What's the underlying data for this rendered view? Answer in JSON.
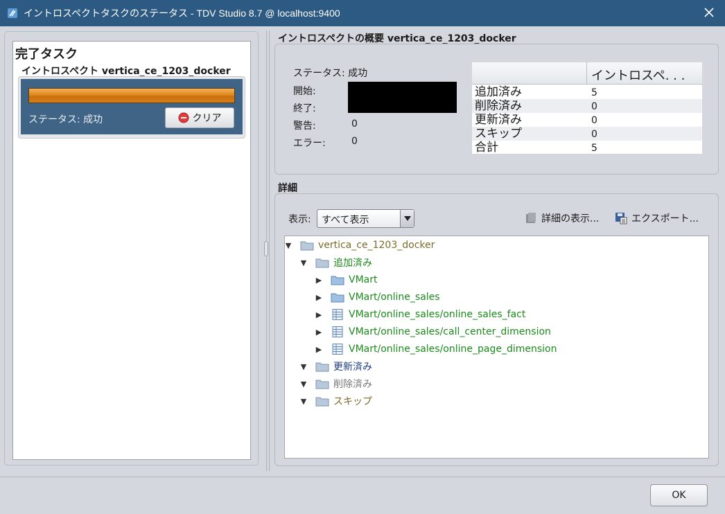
{
  "window": {
    "title": "イントロスペクトタスクのステータス - TDV Studio 8.7 @ localhost:9400",
    "icons": {
      "app": "tdv-app-icon",
      "close": "close-icon"
    }
  },
  "left_panel": {
    "heading": "完了タスク",
    "task": {
      "name": "イントロスペクト vertica_ce_1203_docker",
      "progress": 1.0,
      "status": "ステータス: 成功",
      "clear_button": "クリア",
      "clear_icon": "clear-icon"
    }
  },
  "summary": {
    "heading": "イントロスペクトの概要  vertica_ce_1203_docker",
    "status": "ステータス: 成功",
    "start_label": "開始:",
    "end_label": "終了:",
    "warnings_label": "警告:",
    "warnings_value": "0",
    "errors_label": "エラー:",
    "errors_value": "0",
    "table": {
      "column_header": "イントロスペ. . .",
      "rows": [
        {
          "label": "追加済み",
          "value": "5"
        },
        {
          "label": "削除済み",
          "value": "0"
        },
        {
          "label": "更新済み",
          "value": "0"
        },
        {
          "label": "スキップ",
          "value": "0"
        },
        {
          "label": "合計",
          "value": "5"
        }
      ]
    }
  },
  "details": {
    "heading": "詳細",
    "show_label": "表示:",
    "show_select": "すべて表示",
    "details_button": "詳細の表示...",
    "export_button": "エクスポート...",
    "tree": {
      "root": "vertica_ce_1203_docker",
      "added": "追加済み",
      "added_items": [
        "VMart",
        "VMart/online_sales",
        "VMart/online_sales/online_sales_fact",
        "VMart/online_sales/call_center_dimension",
        "VMart/online_sales/online_page_dimension"
      ],
      "updated": "更新済み",
      "deleted": "削除済み",
      "skipped": "スキップ"
    }
  },
  "footer": {
    "ok_button": "OK"
  },
  "colors": {
    "titlebar": "#2d5a82",
    "added": "#1b8a1b",
    "updated": "#1c3b84",
    "skipped": "#7a6a2a",
    "progress": "#e18a1d"
  }
}
